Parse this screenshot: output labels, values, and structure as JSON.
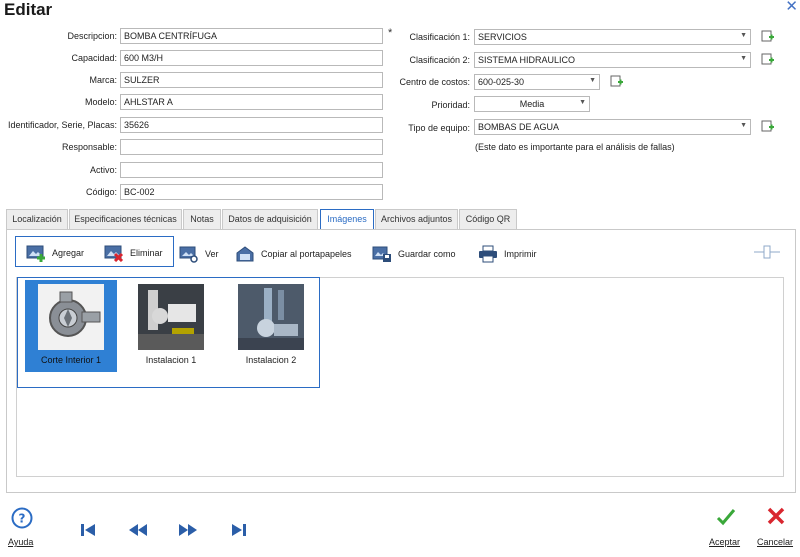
{
  "window": {
    "title": "Editar"
  },
  "colors": {
    "accent": "#2b6cc4",
    "selection": "#2f80d4",
    "ok": "#3aa83a",
    "cancel": "#d9262f",
    "add": "#3aa83a"
  },
  "form": {
    "descripcion": {
      "label": "Descripcion:",
      "value": "BOMBA CENTRÍFUGA",
      "required": "*"
    },
    "capacidad": {
      "label": "Capacidad:",
      "value": "600 M3/H"
    },
    "marca": {
      "label": "Marca:",
      "value": "SULZER"
    },
    "modelo": {
      "label": "Modelo:",
      "value": "AHLSTAR A"
    },
    "identificador": {
      "label": "Identificador, Serie, Placas:",
      "value": "35626"
    },
    "responsable": {
      "label": "Responsable:",
      "value": ""
    },
    "activo": {
      "label": "Activo:",
      "value": ""
    },
    "codigo": {
      "label": "Código:",
      "value": "BC-002"
    },
    "clasificacion1": {
      "label": "Clasificación 1:",
      "value": "SERVICIOS"
    },
    "clasificacion2": {
      "label": "Clasificación 2:",
      "value": "SISTEMA HIDRAULICO"
    },
    "centro_costos": {
      "label": "Centro de costos:",
      "value": "600-025-30"
    },
    "prioridad": {
      "label": "Prioridad:",
      "value": "Media"
    },
    "tipo_equipo": {
      "label": "Tipo de equipo:",
      "value": "BOMBAS DE AGUA",
      "note": "(Este dato es importante para el análisis de fallas)"
    }
  },
  "tabs": [
    {
      "label": "Localización"
    },
    {
      "label": "Especificaciones técnicas"
    },
    {
      "label": "Notas"
    },
    {
      "label": "Datos de adquisición"
    },
    {
      "label": "Imágenes",
      "active": true
    },
    {
      "label": "Archivos adjuntos"
    },
    {
      "label": "Código QR"
    }
  ],
  "toolbar": {
    "agregar": "Agregar",
    "eliminar": "Eliminar",
    "ver": "Ver",
    "copiar": "Copiar al portapapeles",
    "guardar": "Guardar como",
    "imprimir": "Imprimir"
  },
  "images": [
    {
      "caption": "Corte Interior 1",
      "selected": true
    },
    {
      "caption": "Instalacion 1",
      "selected": false
    },
    {
      "caption": "Instalacion 2",
      "selected": false
    }
  ],
  "footer": {
    "ayuda": "Ayuda",
    "aceptar": "Aceptar",
    "cancelar": "Cancelar"
  }
}
